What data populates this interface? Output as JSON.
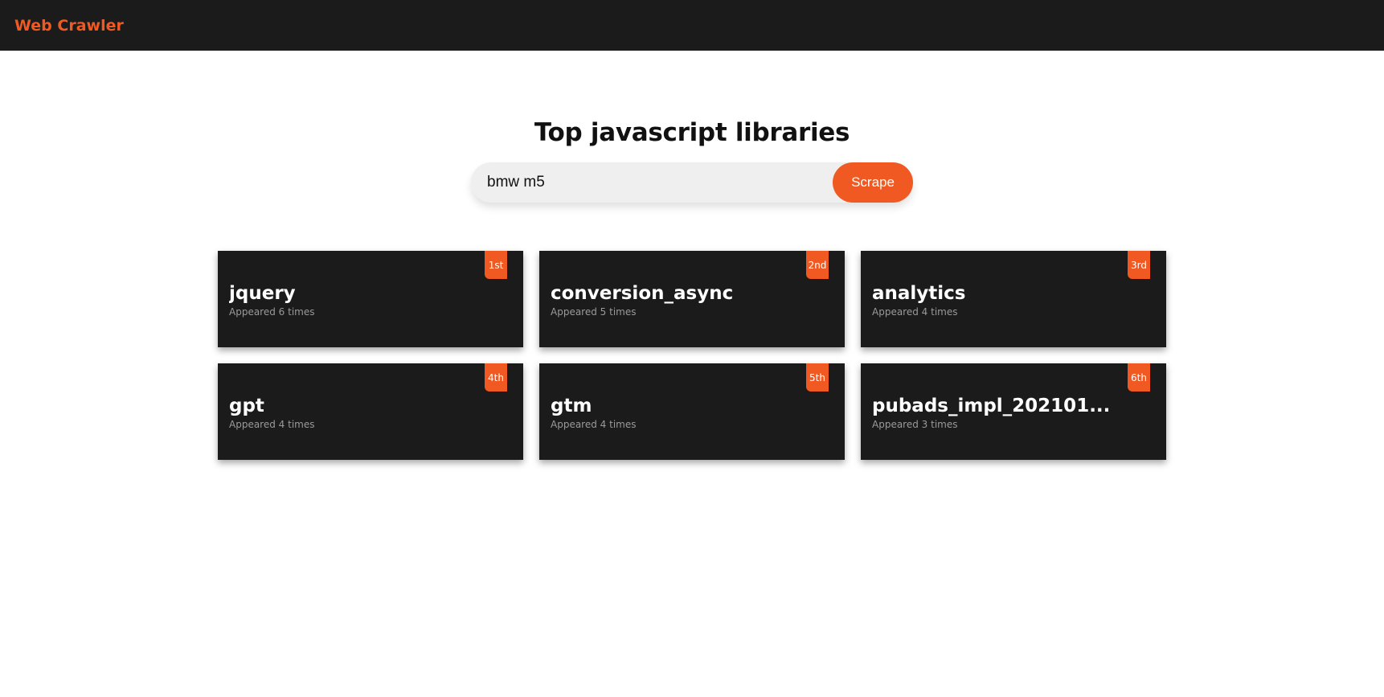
{
  "colors": {
    "accent": "#f05a22",
    "navbar_bg": "#1b1b1b",
    "card_bg": "#1b1b1b"
  },
  "navbar": {
    "brand": "Web Crawler"
  },
  "main": {
    "title": "Top javascript libraries",
    "search": {
      "value": "bmw m5",
      "button_label": "Scrape"
    },
    "results": [
      {
        "rank": "1st",
        "name": "jquery",
        "count_text": "Appeared 6 times"
      },
      {
        "rank": "2nd",
        "name": "conversion_async",
        "count_text": "Appeared 5 times"
      },
      {
        "rank": "3rd",
        "name": "analytics",
        "count_text": "Appeared 4 times"
      },
      {
        "rank": "4th",
        "name": "gpt",
        "count_text": "Appeared 4 times"
      },
      {
        "rank": "5th",
        "name": "gtm",
        "count_text": "Appeared 4 times"
      },
      {
        "rank": "6th",
        "name": "pubads_impl_202101...",
        "count_text": "Appeared 3 times"
      }
    ]
  }
}
